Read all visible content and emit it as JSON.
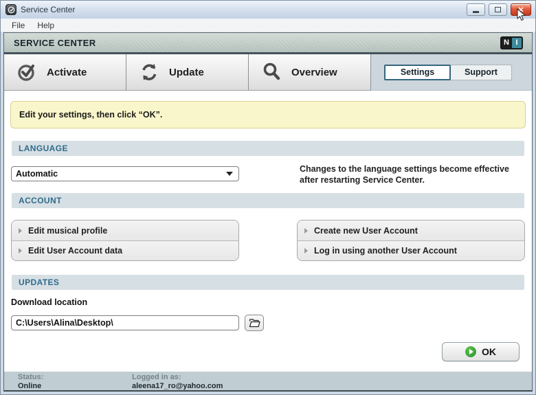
{
  "window": {
    "title": "Service Center",
    "controls": {
      "minimize": "minimize",
      "maximize": "maximize",
      "close": "close"
    }
  },
  "menu": {
    "items": [
      "File",
      "Help"
    ]
  },
  "header": {
    "title": "SERVICE CENTER",
    "logo_n": "N",
    "logo_i": "I"
  },
  "nav": {
    "buttons": [
      {
        "label": "Activate",
        "icon": "check-circle-icon"
      },
      {
        "label": "Update",
        "icon": "refresh-icon"
      },
      {
        "label": "Overview",
        "icon": "magnifier-icon"
      }
    ],
    "tabs": [
      {
        "label": "Settings",
        "active": true
      },
      {
        "label": "Support",
        "active": false
      }
    ]
  },
  "notice": {
    "text": "Edit your settings, then click “OK”."
  },
  "sections": {
    "language": {
      "title": "LANGUAGE",
      "dropdown_value": "Automatic",
      "note_line1": "Changes to the language settings become effective",
      "note_line2": "after restarting Service Center."
    },
    "account": {
      "title": "ACCOUNT",
      "left_buttons": [
        "Edit musical profile",
        "Edit User Account data"
      ],
      "right_buttons": [
        "Create new User Account",
        "Log in using another User Account"
      ]
    },
    "updates": {
      "title": "UPDATES",
      "download_label": "Download location",
      "download_path": "C:\\Users\\Alina\\Desktop\\"
    }
  },
  "ok_button": {
    "label": "OK"
  },
  "statusbar": {
    "status_label": "Status:",
    "status_value": "Online",
    "logged_label": "Logged in as:",
    "logged_value": "aleena17_ro@yahoo.com"
  },
  "colors": {
    "section_header_bg": "#d6dfe4",
    "section_header_text": "#2f6b8a",
    "notice_bg": "#faf6cb",
    "notice_border": "#ddd095",
    "ok_green": "#2c9330",
    "ni_teal": "#3f8b9b",
    "tab_active_border": "#34667f",
    "statusbar_bg": "#c0cdd3",
    "close_button_red": "#c03a1f"
  }
}
